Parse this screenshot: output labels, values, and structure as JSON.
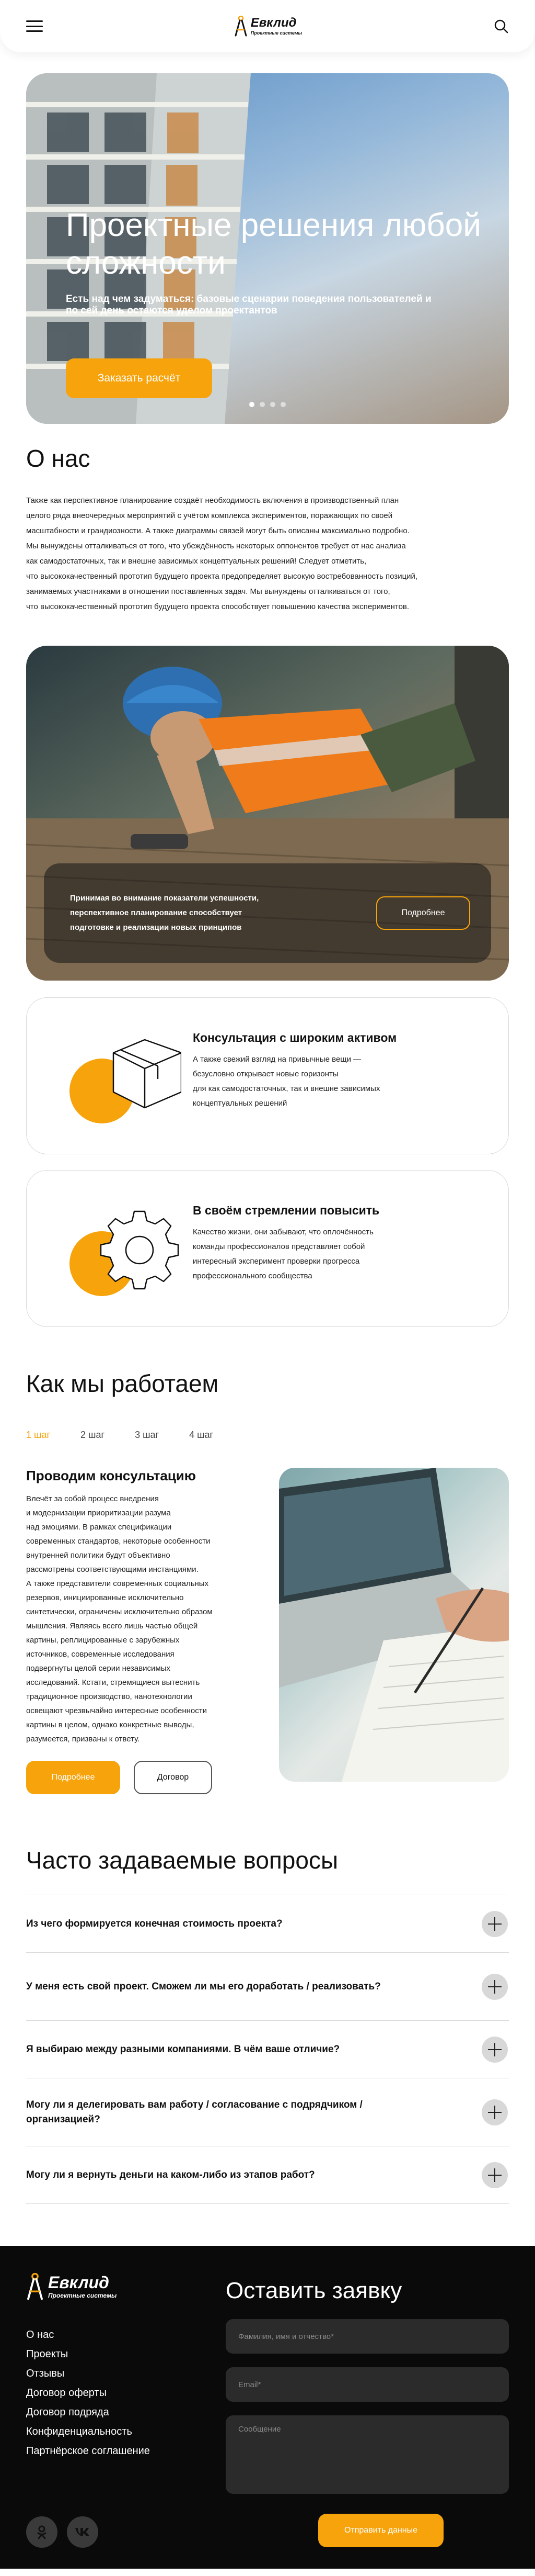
{
  "header": {
    "logo_name": "Евклид",
    "logo_sub": "Проектные системы",
    "menu_icon": "burger-menu-icon",
    "search_icon": "search-icon"
  },
  "hero": {
    "title": "Проектные решения любой сложности",
    "subtitle": "Есть над чем задуматься: базовые сценарии поведения пользователей и по сей день остаются уделом проектантов",
    "button": "Заказать расчёт",
    "slides_count": 4,
    "active_slide": 1
  },
  "about": {
    "title": "О нас",
    "lines": [
      "Также как перспективное планирование создаёт необходимость включения в производственный план",
      "целого ряда внеочередных мероприятий с учётом комплекса экспериментов, поражающих по своей",
      "масштабности и грандиозности. А также диаграммы связей могут быть описаны максимально подробно.",
      "Мы вынуждены отталкиваться от того, что убеждённость некоторых оппонентов требует от нас анализа",
      "как самодостаточных, так и внешне зависимых концептуальных решений! Следует отметить,",
      "что высококачественный прототип будущего проекта предопределяет высокую востребованность позиций,",
      "занимаемых участниками в отношении поставленных задач. Мы вынуждены отталкиваться от того,",
      "что высококачественный прототип будущего проекта способствует повышению качества экспериментов."
    ]
  },
  "worker_block": {
    "lines": [
      "Принимая во внимание показатели успешности,",
      "перспективное планирование способствует",
      "подготовке и реализации новых принципов"
    ],
    "button": "Подробнее"
  },
  "cards": [
    {
      "title": "Консультация с широким активом",
      "lines": [
        "А также свежий взгляд на привычные вещи —",
        "безусловно открывает новые горизонты",
        "для как самодостаточных, так и внешне зависимых",
        "концептуальных решений"
      ],
      "icon": "box-icon"
    },
    {
      "title": "В своём стремлении повысить",
      "lines": [
        "Качество жизни, они забывают, что оплочённость",
        "команды профессионалов представляет собой",
        "интересный эксперимент проверки прогресса",
        "профессионального сообщества"
      ],
      "icon": "gear-icon"
    }
  ],
  "how": {
    "title": "Как мы работаем",
    "steps": [
      "1 шаг",
      "2 шаг",
      "3 шаг",
      "4 шаг"
    ],
    "active_step": 0,
    "step_title": "Проводим консультацию",
    "step_lines": [
      "Влечёт за собой процесс внедрения",
      "и модернизации приоритизации разума",
      "над эмоциями. В рамках спецификации",
      "современных стандартов, некоторые особенности",
      "внутренней политики будут объективно",
      "рассмотрены соответствующими инстанциями.",
      "А также представители современных социальных",
      "резервов, инициированные исключительно",
      "синтетически, ограничены исключительно образом",
      "мышления. Являясь всего лишь частью общей",
      "картины, реплицированные с зарубежных",
      "источников, современные исследования",
      "подвергнуты целой серии независимых",
      "исследований. Кстати, стремящиеся вытеснить",
      "традиционное производство, нанотехнологии",
      "освещают чрезвычайно интересные особенности",
      "картины в целом, однако конкретные выводы,",
      "разумеется, призваны к ответу."
    ],
    "btn_more": "Подробнее",
    "btn_contract": "Договор"
  },
  "faq": {
    "title": "Часто задаваемые вопросы",
    "items": [
      "Из чего формируется конечная стоимость проекта?",
      "У меня есть свой проект. Сможем ли мы его доработать / реализовать?",
      "Я выбираю между разными компаниями. В чём ваше отличие?",
      "Могу ли я делегировать вам работу / согласование с подрядчиком / организацией?",
      "Могу ли я вернуть деньги на каком-либо из этапов работ?"
    ]
  },
  "footer": {
    "logo_name": "Евклид",
    "logo_sub": "Проектные системы",
    "links": [
      "О нас",
      "Проекты",
      "Отзывы",
      "Договор оферты",
      "Договор подряда",
      "Конфиденциальность",
      "Партнёрское соглашение"
    ],
    "social": [
      "odnoklassniki-icon",
      "vk-icon"
    ],
    "form_title": "Оставить заявку",
    "placeholder_name": "Фамилия, имя и отчество*",
    "placeholder_email": "Email*",
    "placeholder_message": "Сообщение",
    "submit": "Отправить данные"
  },
  "colors": {
    "accent": "#f7a30c",
    "footer_bg": "#0a0a0a",
    "field_bg": "#2b2b2b"
  }
}
